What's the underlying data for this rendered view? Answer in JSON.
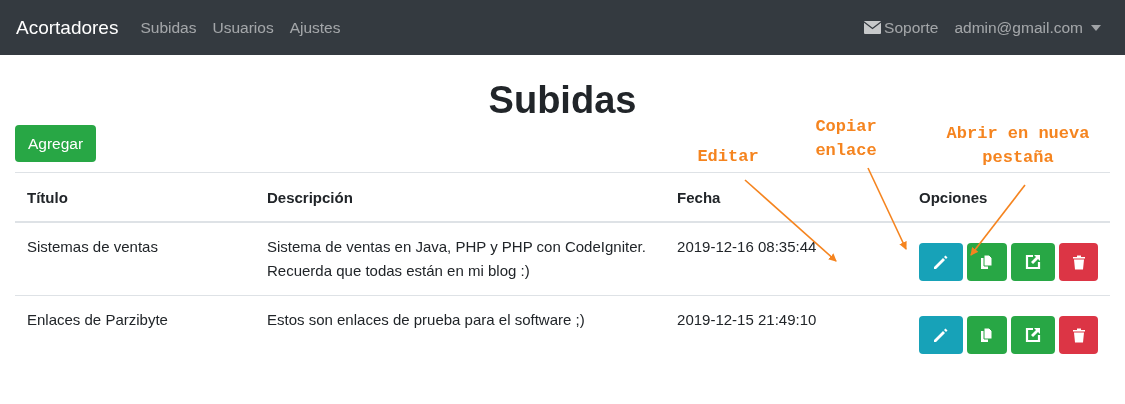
{
  "navbar": {
    "brand": "Acortadores",
    "links": [
      {
        "label": "Subidas"
      },
      {
        "label": "Usuarios"
      },
      {
        "label": "Ajustes"
      }
    ],
    "support": "Soporte",
    "user": "admin@gmail.com"
  },
  "heading": "Subidas",
  "add_button": "Agregar",
  "table": {
    "columns": [
      "Título",
      "Descripción",
      "Fecha",
      "Opciones"
    ],
    "rows": [
      {
        "title": "Sistemas de ventas",
        "description": "Sistema de ventas en Java, PHP y PHP con CodeIgniter. Recuerda que todas están en mi blog :)",
        "date": "2019-12-16 08:35:44",
        "actions": [
          {
            "kind": "edit"
          },
          {
            "kind": "copy"
          },
          {
            "kind": "open"
          },
          {
            "kind": "delete"
          }
        ]
      },
      {
        "title": "Enlaces de Parzibyte",
        "description": "Estos son enlaces de prueba para el software ;)",
        "date": "2019-12-15 21:49:10",
        "actions": [
          {
            "kind": "edit"
          },
          {
            "kind": "copy"
          },
          {
            "kind": "open"
          },
          {
            "kind": "delete"
          }
        ]
      }
    ]
  },
  "annotations": [
    {
      "text": "Editar"
    },
    {
      "text": "Copiar enlace"
    },
    {
      "text": "Abrir en nueva pestaña"
    }
  ]
}
